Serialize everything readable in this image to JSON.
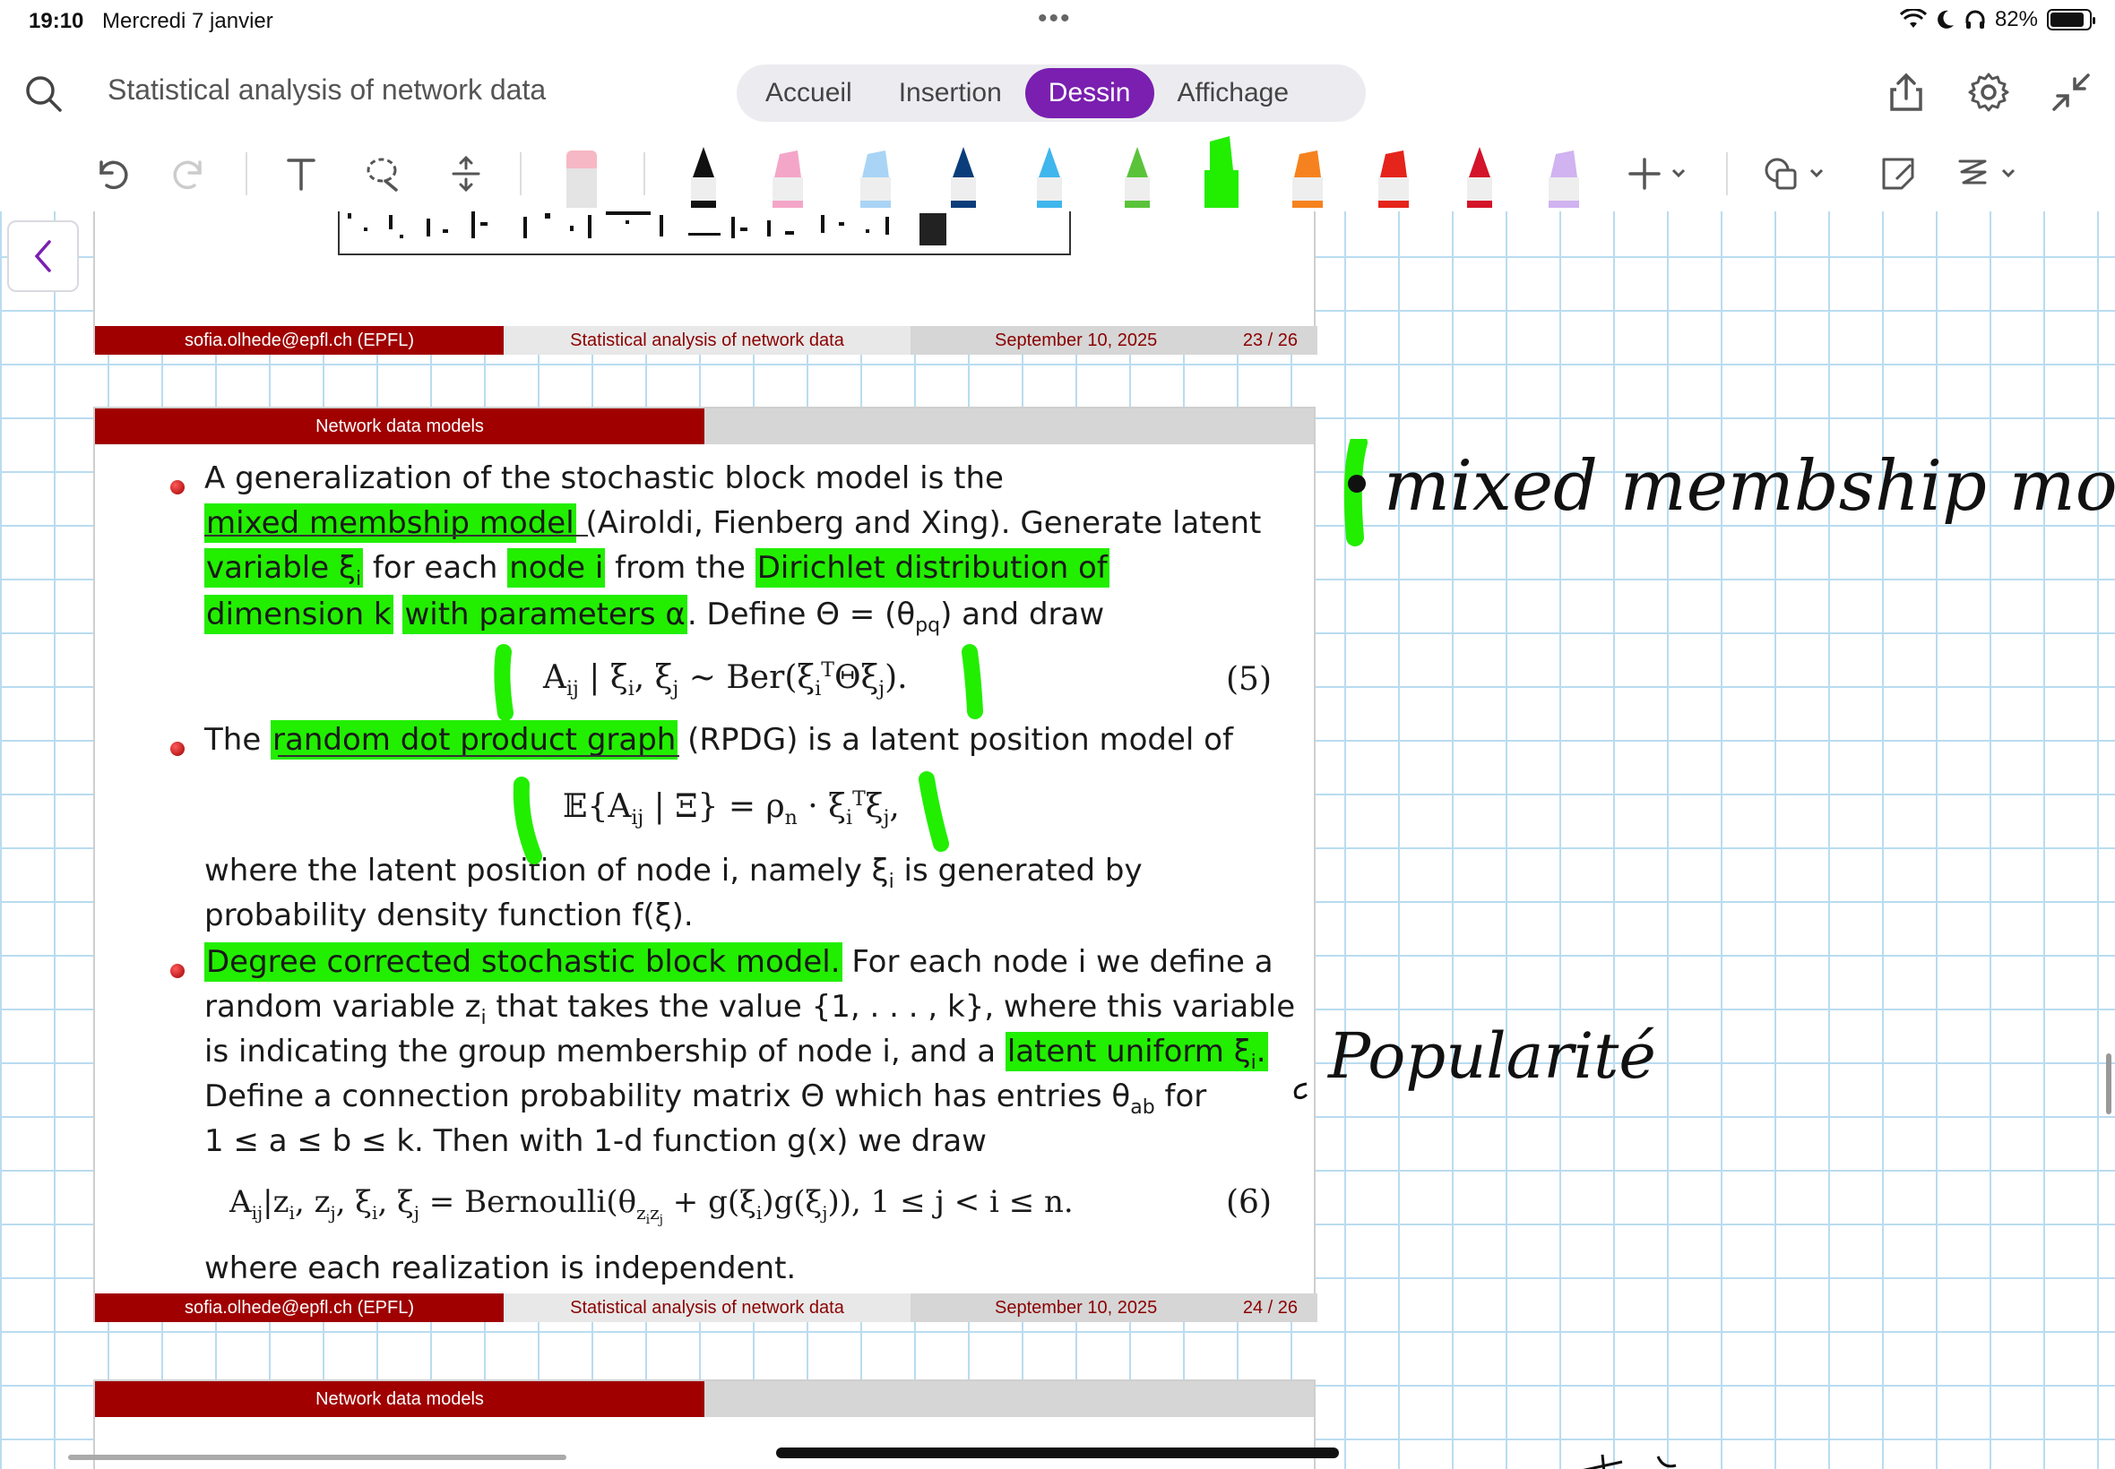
{
  "status_bar": {
    "time": "19:10",
    "date": "Mercredi 7 janvier",
    "battery": "82%"
  },
  "header": {
    "document_title": "Statistical analysis of network data",
    "tabs": [
      {
        "label": "Accueil",
        "active": false
      },
      {
        "label": "Insertion",
        "active": false
      },
      {
        "label": "Dessin",
        "active": true
      },
      {
        "label": "Affichage",
        "active": false
      }
    ]
  },
  "toolbar": {
    "pens": [
      {
        "name": "black-pen",
        "color": "#111111"
      },
      {
        "name": "pink-highlighter",
        "color": "#f4a6c8"
      },
      {
        "name": "light-blue-highlighter",
        "color": "#a9d4f5"
      },
      {
        "name": "navy-pen",
        "color": "#0a3d7a"
      },
      {
        "name": "cyan-pen",
        "color": "#3fb6ec"
      },
      {
        "name": "green-pen",
        "color": "#5ac33a"
      },
      {
        "name": "green-highlighter",
        "color": "#22ee00"
      },
      {
        "name": "orange-highlighter",
        "color": "#f5821f"
      },
      {
        "name": "red-highlighter",
        "color": "#e5241b"
      },
      {
        "name": "red-pen",
        "color": "#d3142a"
      },
      {
        "name": "lavender-highlighter",
        "color": "#d0b3f0"
      }
    ]
  },
  "slides": {
    "slide23_footer": {
      "author": "sofia.olhede@epfl.ch  (EPFL)",
      "title": "Statistical analysis of network data",
      "date": "September 10, 2025",
      "page": "23 / 26"
    },
    "slide24": {
      "section": "Network data models",
      "b1_l1": "A generalization of the stochastic block model is the",
      "b1_l2_hl": "mixed membship model",
      "b1_l2_rest": " (Airoldi, Fienberg and Xing). Generate latent",
      "b1_l3_hl1": "variable ξ",
      "b1_l3_hl1_sub": "i",
      "b1_l3_mid": " for each ",
      "b1_l3_hl2": "node i",
      "b1_l3_mid2": " from the ",
      "b1_l3_hl3": "Dirichlet distribution of",
      "b1_l4_hl1": "dimension k",
      "b1_l4_hl2": "with parameters α",
      "b1_l4_rest": ". Define Θ = (θ",
      "b1_l4_sub": "pq",
      "b1_l4_end": ") and draw",
      "eq5": "A",
      "eq5_sub": "ij",
      "eq5_rest": " | ξ",
      "eq5_sub2": "i",
      "eq5_rest2": ", ξ",
      "eq5_sub3": "j",
      "eq5_rest3": " ~ Ber(ξ",
      "eq5_sub4": "i",
      "eq5_sup4": "T",
      "eq5_rest4": "Θξ",
      "eq5_sub5": "j",
      "eq5_rest5": ").",
      "eq5_num": "(5)",
      "b2_l1_pre": "The ",
      "b2_l1_hl": "random dot product graph",
      "b2_l1_rest": " (RPDG) is a latent position model of",
      "eq_rpdg": "𝔼{A",
      "eq_rpdg_sub": "ij",
      "eq_rpdg_rest": " | Ξ} = ρ",
      "eq_rpdg_sub2": "n",
      "eq_rpdg_rest2": " · ξ",
      "eq_rpdg_sub3": "i",
      "eq_rpdg_sup3": "T",
      "eq_rpdg_rest3": "ξ",
      "eq_rpdg_sub4": "j",
      "eq_rpdg_end": ",",
      "b2_l2": "where the latent position of node i, namely ξ",
      "b2_l2_sub": "i",
      "b2_l2_end": " is generated by",
      "b2_l3": "probability density function f(ξ).",
      "b3_l1_hl": "Degree corrected stochastic block model.",
      "b3_l1_rest": " For each node i we define a",
      "b3_l2": "random variable z",
      "b3_l2_sub": "i",
      "b3_l2_end": " that takes the value {1, . . . , k}, where this variable",
      "b3_l3": "is indicating the group membership of node i, and a ",
      "b3_l3_hl": "latent uniform ξ",
      "b3_l3_hl_sub": "i",
      "b3_l3_end": ".",
      "b3_l4": "Define a connection probability matrix Θ which has entries θ",
      "b3_l4_sub": "ab",
      "b3_l4_end": " for",
      "b3_l5": "1 ≤ a ≤ b ≤ k. Then with 1-d function g(x) we draw",
      "eq6": "A",
      "eq6_sub": "ij",
      "eq6_rest": "|z",
      "eq6_sub2": "i",
      "eq6_rest2": ", z",
      "eq6_sub3": "j",
      "eq6_rest3": ", ξ",
      "eq6_sub4": "i",
      "eq6_rest4": ", ξ",
      "eq6_sub5": "j",
      "eq6_rest5": " = Bernoulli(θ",
      "eq6_sub6": "z",
      "eq6_sub6b": "i",
      "eq6_sub6c": "z",
      "eq6_sub6d": "j",
      "eq6_rest6": " + g(ξ",
      "eq6_sub7": "i",
      "eq6_rest7": ")g(ξ",
      "eq6_sub8": "j",
      "eq6_rest8": ")),   1 ≤ j < i ≤ n.",
      "eq6_num": "(6)",
      "b3_l6": "where each realization is independent.",
      "footer": {
        "author": "sofia.olhede@epfl.ch  (EPFL)",
        "title": "Statistical analysis of network data",
        "date": "September 10, 2025",
        "page": "24 / 26"
      }
    },
    "slide25": {
      "section": "Network data models"
    }
  },
  "handwriting": {
    "note1": "mixed membship mod",
    "note2": "Popularité"
  }
}
